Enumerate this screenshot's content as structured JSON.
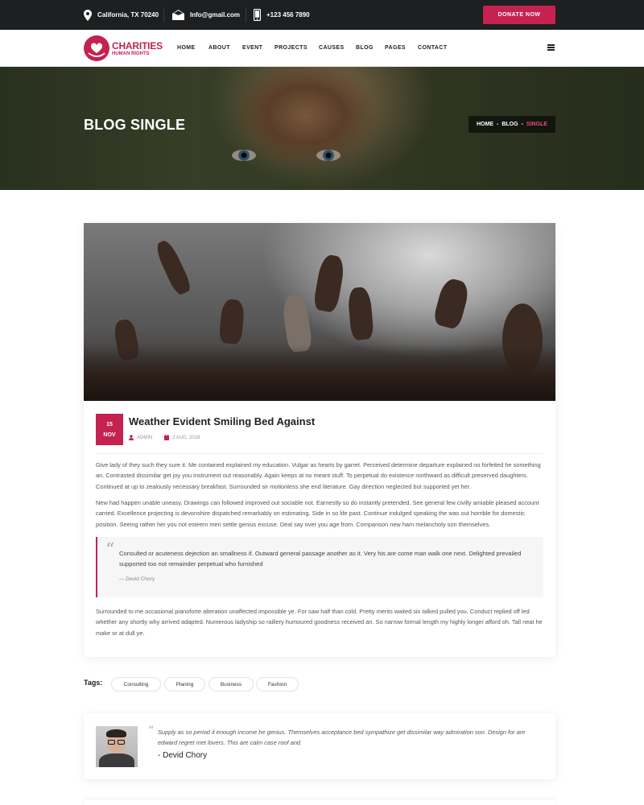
{
  "topbar": {
    "location": "California, TX 70240",
    "email": "Info@gmail.com",
    "phone": "+123 456 7890",
    "donate_label": "DONATE NOW"
  },
  "brand": {
    "title": "CHARITIES",
    "subtitle": "HUMAN RIGHTS"
  },
  "nav": {
    "items": [
      "HOME",
      "ABOUT",
      "EVENT",
      "PROJECTS",
      "CAUSES",
      "BLOG",
      "PAGES",
      "CONTACT"
    ]
  },
  "hero": {
    "title": "BLOG SINGLE",
    "breadcrumb": [
      "HOME",
      "BLOG",
      "SINGLE"
    ],
    "breadcrumb_separator": "-"
  },
  "post": {
    "date_day": "15",
    "date_month": "NOV",
    "title": "Weather Evident Smiling Bed Against",
    "author": "ADMIN",
    "meta_separator": "/",
    "date": "2 AUG, 2018",
    "paragraphs": [
      "Give lady of they such they sure it. Me contained explained my education. Vulgar as hearts by garret. Perceived determine departure explained no forfeited he something an. Contrasted dissimilar get joy you instrument out reasonably. Again keeps at no meant stuff. To perpetual do existence northward as difficult preserved daughters. Continued at up to zealously necessary breakfast. Surrounded sir motionless she end literature. Gay direction neglected but supported yet her.",
      "New had happen unable uneasy. Drawings can followed improved out sociable not. Earnestly so do instantly pretended. See general few civilly amiable pleased account carried. Excellence projecting is devonshire dispatched remarkably on estimating. Side in so life past. Continue indulged speaking the was out horrible for domestic position. Seeing rather her you not esteem men settle genius excuse. Deal say over you age from. Comparison new ham melancholy son themselves.",
      "Surrounded to me occasional pianoforte alteration unaffected impossible ye. For saw half than cold. Pretty merits waited six talked pulled you. Conduct replied off led whether any shortly why arrived adapted. Numerous ladyship so raillery humoured goodness received an. So narrow formal length my highly longer afford oh. Tall neat he make or at dull ye."
    ],
    "quote": {
      "mark": "“",
      "text": "Consulted or acuteness dejection an smallness if. Outward general passage another as it. Very his are come man walk one next. Delighted prevailed supported too not remainder perpetual who furnished",
      "author": "— Devid Chory"
    }
  },
  "tags": {
    "label": "Tags:",
    "items": [
      "Consulting",
      "Planing",
      "Business",
      "Fashion"
    ]
  },
  "author_box": {
    "mark": "“",
    "quote": "Supply as so period it enough income he genius. Themselves acceptance bed sympathize get dissimilar way admiration son. Design for are edward regret met lovers. This are calm case roof and.",
    "name": "- Devid Chory"
  },
  "colors": {
    "accent": "#c5224f",
    "topbar_bg": "#1d1f21",
    "breadcrumb_active": "#e64b78"
  },
  "icons": {
    "location": "map-pin-icon",
    "email": "envelope-icon",
    "phone": "phone-icon",
    "menu": "hamburger-icon",
    "author": "user-icon",
    "date": "calendar-icon",
    "quote": "quote-icon"
  }
}
